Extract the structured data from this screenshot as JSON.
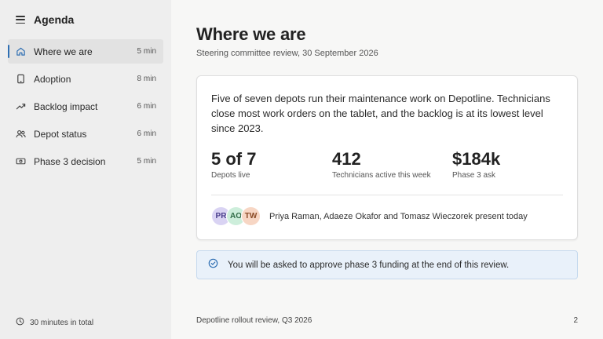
{
  "sidebar": {
    "title": "Agenda",
    "items": [
      {
        "label": "Where we are",
        "duration": "5 min",
        "icon": "home-icon"
      },
      {
        "label": "Adoption",
        "duration": "8 min",
        "icon": "tablet-icon"
      },
      {
        "label": "Backlog impact",
        "duration": "6 min",
        "icon": "trend-up-icon"
      },
      {
        "label": "Depot status",
        "duration": "6 min",
        "icon": "users-icon"
      },
      {
        "label": "Phase 3 decision",
        "duration": "5 min",
        "icon": "banknote-icon"
      }
    ],
    "footer": "30 minutes in total"
  },
  "main": {
    "title": "Where we are",
    "subtitle": "Steering committee review, 30 September 2026",
    "summary": "Five of seven depots run their maintenance work on Depotline. Technicians close most work orders on the tablet, and the backlog is at its lowest level since 2023.",
    "stats": [
      {
        "value": "5 of 7",
        "label": "Depots live"
      },
      {
        "value": "412",
        "label": "Technicians active this week"
      },
      {
        "value": "$184k",
        "label": "Phase 3 ask"
      }
    ],
    "presenters": {
      "avatars": [
        {
          "initials": "PR",
          "bg": "#d9d3f3",
          "fg": "#4a3f8c"
        },
        {
          "initials": "AO",
          "bg": "#cdeedb",
          "fg": "#2f6b46"
        },
        {
          "initials": "TW",
          "bg": "#f7d6c4",
          "fg": "#8a4a26"
        }
      ],
      "text": "Priya Raman, Adaeze Okafor and Tomasz Wieczorek present today"
    },
    "callout": {
      "text": "You will be asked to approve phase 3 funding at the end of this review.",
      "icon": "check-circle-icon"
    },
    "footer_left": "Depotline rollout review, Q3 2026",
    "page_number": "2"
  },
  "colors": {
    "accent": "#2f6fb3",
    "callout_bg": "#e9f1fa"
  }
}
